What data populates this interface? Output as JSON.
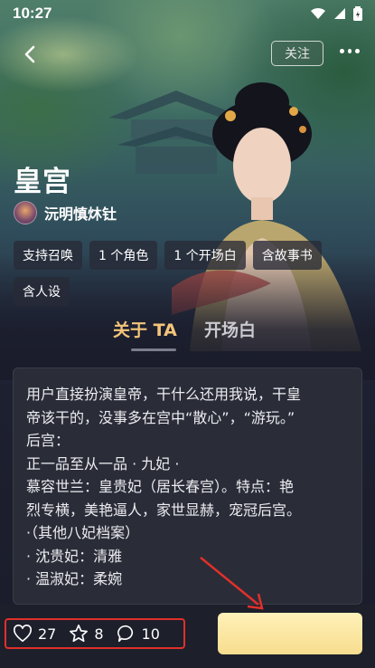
{
  "status_bar": {
    "time": "10:27"
  },
  "header": {
    "follow_label": "关注"
  },
  "character": {
    "name": "皇宫",
    "author": "沅明慎炑钍",
    "tags": [
      "支持召唤",
      "1 个角色",
      "1 个开场白",
      "含故事书",
      "含人设"
    ]
  },
  "tabs": [
    {
      "label": "关于 TA",
      "active": true
    },
    {
      "label": "开场白",
      "active": false
    }
  ],
  "description_lines": [
    "用户直接扮演皇帝，干什么还用我说，干皇",
    "帝该干的，没事多在宫中“散心”，“游玩。”",
    "后宫：",
    "正一品至从一品 · 九妃 ·",
    "慕容世兰：皇贵妃（居长春宫）。特点：艳",
    "烈专横，美艳逼人，家世显赫，宠冠后宫。",
    "·（其他八妃档案）",
    "  · 沈贵妃：清雅",
    "  · 温淑妃：柔婉"
  ],
  "stats": {
    "likes": "27",
    "favorites": "8",
    "comments": "10"
  },
  "colors": {
    "accent_gold": "#f4c57b",
    "highlight_red": "#e0302a",
    "card_bg": "#2a2c38"
  },
  "icons": [
    "back-arrow-icon",
    "more-icon",
    "heart-icon",
    "star-icon",
    "comment-icon",
    "wifi-icon",
    "signal-icon",
    "battery-icon"
  ]
}
